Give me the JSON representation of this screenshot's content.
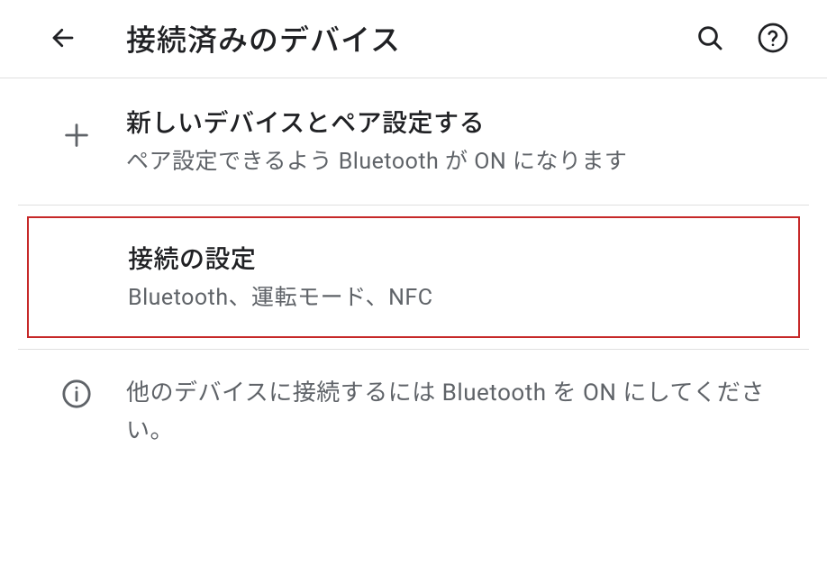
{
  "header": {
    "title": "接続済みのデバイス"
  },
  "items": {
    "pair": {
      "title": "新しいデバイスとペア設定する",
      "subtitle": "ペア設定できるよう Bluetooth が ON になります"
    },
    "settings": {
      "title": "接続の設定",
      "subtitle": "Bluetooth、運転モード、NFC"
    }
  },
  "info": {
    "text": "他のデバイスに接続するには Bluetooth を ON にしてください。"
  }
}
